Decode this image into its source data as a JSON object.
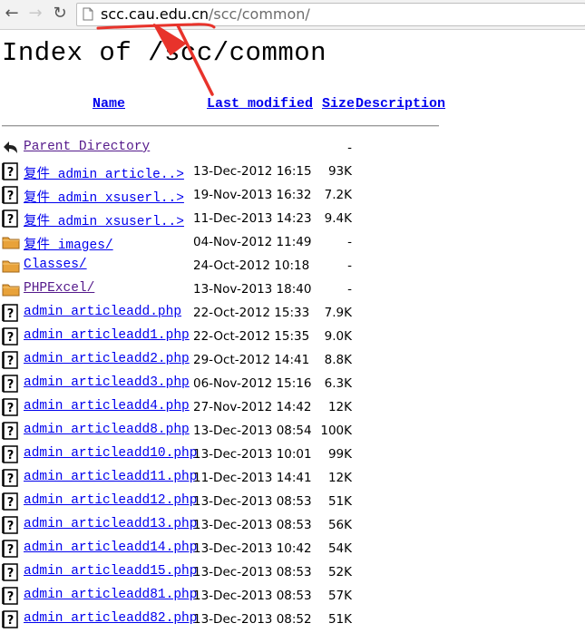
{
  "browser": {
    "back_icon": "back-arrow-icon",
    "forward_icon": "forward-arrow-icon",
    "reload_icon": "reload-icon",
    "url_host": "scc.cau.edu.cn",
    "url_path": "/scc/common/"
  },
  "page": {
    "title": "Index of /scc/common",
    "columns": {
      "name": "Name",
      "last_modified": "Last modified",
      "size": "Size",
      "description": "Description"
    }
  },
  "entries": [
    {
      "icon": "back-icon",
      "name": "Parent Directory",
      "date": "",
      "size": "-"
    },
    {
      "icon": "unknown-file-icon",
      "name": "复件 admin article..>",
      "date": "13-Dec-2012 16:15",
      "size": "93K"
    },
    {
      "icon": "unknown-file-icon",
      "name": "复件 admin xsuserl..>",
      "date": "19-Nov-2013 16:32",
      "size": "7.2K"
    },
    {
      "icon": "unknown-file-icon",
      "name": "复件 admin xsuserl..>",
      "date": "11-Dec-2013 14:23",
      "size": "9.4K"
    },
    {
      "icon": "folder-icon",
      "name": "复件 images/",
      "date": "04-Nov-2012 11:49",
      "size": "-"
    },
    {
      "icon": "folder-icon",
      "name": "Classes/",
      "date": "24-Oct-2012 10:18",
      "size": "-"
    },
    {
      "icon": "folder-icon",
      "name": "PHPExcel/",
      "date": "13-Nov-2013 18:40",
      "size": "-"
    },
    {
      "icon": "unknown-file-icon",
      "name": "admin articleadd.php",
      "date": "22-Oct-2012 15:33",
      "size": "7.9K"
    },
    {
      "icon": "unknown-file-icon",
      "name": "admin articleadd1.php",
      "date": "22-Oct-2012 15:35",
      "size": "9.0K"
    },
    {
      "icon": "unknown-file-icon",
      "name": "admin articleadd2.php",
      "date": "29-Oct-2012 14:41",
      "size": "8.8K"
    },
    {
      "icon": "unknown-file-icon",
      "name": "admin articleadd3.php",
      "date": "06-Nov-2012 15:16",
      "size": "6.3K"
    },
    {
      "icon": "unknown-file-icon",
      "name": "admin articleadd4.php",
      "date": "27-Nov-2012 14:42",
      "size": "12K"
    },
    {
      "icon": "unknown-file-icon",
      "name": "admin articleadd8.php",
      "date": "13-Dec-2013 08:54",
      "size": "100K"
    },
    {
      "icon": "unknown-file-icon",
      "name": "admin articleadd10.php",
      "date": "13-Dec-2013 10:01",
      "size": "99K"
    },
    {
      "icon": "unknown-file-icon",
      "name": "admin articleadd11.php",
      "date": "11-Dec-2013 14:41",
      "size": "12K"
    },
    {
      "icon": "unknown-file-icon",
      "name": "admin articleadd12.php",
      "date": "13-Dec-2013 08:53",
      "size": "51K"
    },
    {
      "icon": "unknown-file-icon",
      "name": "admin articleadd13.php",
      "date": "13-Dec-2013 08:53",
      "size": "56K"
    },
    {
      "icon": "unknown-file-icon",
      "name": "admin articleadd14.php",
      "date": "13-Dec-2013 10:42",
      "size": "54K"
    },
    {
      "icon": "unknown-file-icon",
      "name": "admin articleadd15.php",
      "date": "13-Dec-2013 08:53",
      "size": "52K"
    },
    {
      "icon": "unknown-file-icon",
      "name": "admin articleadd81.php",
      "date": "13-Dec-2013 08:53",
      "size": "57K"
    },
    {
      "icon": "unknown-file-icon",
      "name": "admin articleadd82.php",
      "date": "13-Dec-2013 08:52",
      "size": "51K"
    }
  ],
  "annotation": {
    "color": "#e8332b",
    "icon": "red-arrow-annotation-icon"
  }
}
